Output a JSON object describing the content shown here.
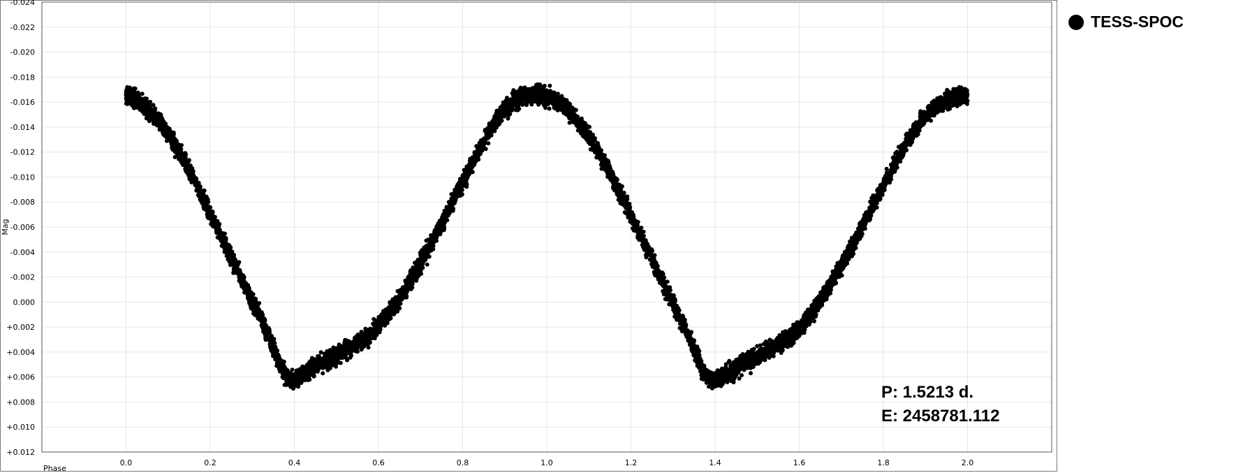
{
  "chart_data": {
    "type": "scatter",
    "title": "",
    "xlabel": "Phase",
    "ylabel": "Mag",
    "xlim": [
      -0.2,
      2.2
    ],
    "ylim": [
      0.012,
      -0.024
    ],
    "y_inverted": true,
    "grid": true,
    "x_ticks": [
      0.0,
      0.2,
      0.4,
      0.6,
      0.8,
      1.0,
      1.2,
      1.4,
      1.6,
      1.8,
      2.0
    ],
    "x_tick_labels": [
      "0.0",
      "0.2",
      "0.4",
      "0.6",
      "0.8",
      "1.0",
      "1.2",
      "1.4",
      "1.6",
      "1.8",
      "2.0"
    ],
    "y_ticks": [
      -0.024,
      -0.022,
      -0.02,
      -0.018,
      -0.016,
      -0.014,
      -0.012,
      -0.01,
      -0.008,
      -0.006,
      -0.004,
      -0.002,
      0.0,
      0.002,
      0.004,
      0.006,
      0.008,
      0.01,
      0.012
    ],
    "y_tick_labels": [
      "-0.024",
      "-0.022",
      "-0.020",
      "-0.018",
      "-0.016",
      "-0.014",
      "-0.012",
      "-0.010",
      "-0.008",
      "-0.006",
      "-0.004",
      "-0.002",
      "0.000",
      "+0.002",
      "+0.004",
      "+0.006",
      "+0.008",
      "+0.010",
      "+0.012"
    ],
    "legend": {
      "placement": "right",
      "entries": [
        "TESS-SPOC"
      ]
    },
    "series": [
      {
        "name": "TESS-SPOC",
        "color": "#000000",
        "marker": "filled-circle",
        "x": [
          0.0,
          0.02,
          0.04,
          0.06,
          0.08,
          0.1,
          0.12,
          0.14,
          0.16,
          0.18,
          0.2,
          0.22,
          0.24,
          0.26,
          0.28,
          0.3,
          0.32,
          0.34,
          0.36,
          0.38,
          0.4,
          0.42,
          0.44,
          0.46,
          0.48,
          0.5,
          0.52,
          0.54,
          0.56,
          0.58,
          0.6,
          0.62,
          0.64,
          0.66,
          0.68,
          0.7,
          0.72,
          0.74,
          0.76,
          0.78,
          0.8,
          0.82,
          0.84,
          0.86,
          0.88,
          0.9,
          0.92,
          0.94,
          0.96,
          0.98,
          1.0,
          1.02,
          1.04,
          1.06,
          1.08,
          1.1,
          1.12,
          1.14,
          1.16,
          1.18,
          1.2,
          1.22,
          1.24,
          1.26,
          1.28,
          1.3,
          1.32,
          1.34,
          1.36,
          1.38,
          1.4,
          1.42,
          1.44,
          1.46,
          1.48,
          1.5,
          1.52,
          1.54,
          1.56,
          1.58,
          1.6,
          1.62,
          1.64,
          1.66,
          1.68,
          1.7,
          1.72,
          1.74,
          1.76,
          1.78,
          1.8,
          1.82,
          1.84,
          1.86,
          1.88,
          1.9,
          1.92,
          1.94,
          1.96,
          1.98,
          2.0
        ],
        "y": [
          -0.0165,
          -0.0163,
          -0.0158,
          -0.0152,
          -0.0145,
          -0.0135,
          -0.0124,
          -0.0112,
          -0.0099,
          -0.0085,
          -0.0071,
          -0.0057,
          -0.0043,
          -0.0029,
          -0.0015,
          -0.0001,
          0.0013,
          0.0027,
          0.0045,
          0.006,
          0.0062,
          0.0058,
          0.0054,
          0.005,
          0.0046,
          0.0043,
          0.0039,
          0.0035,
          0.0031,
          0.0025,
          0.0019,
          0.0011,
          0.0002,
          -0.0008,
          -0.0019,
          -0.0031,
          -0.0043,
          -0.0056,
          -0.0069,
          -0.0082,
          -0.0096,
          -0.0109,
          -0.0122,
          -0.0134,
          -0.0145,
          -0.0154,
          -0.016,
          -0.0164,
          -0.0166,
          -0.0166,
          -0.0165,
          -0.0162,
          -0.0157,
          -0.015,
          -0.0142,
          -0.0132,
          -0.0121,
          -0.0109,
          -0.0096,
          -0.0083,
          -0.0069,
          -0.0055,
          -0.0041,
          -0.0027,
          -0.0013,
          0.0001,
          0.0015,
          0.003,
          0.0046,
          0.006,
          0.0063,
          0.0059,
          0.0055,
          0.0051,
          0.0047,
          0.0044,
          0.004,
          0.0036,
          0.0032,
          0.0027,
          0.0021,
          0.0013,
          0.0004,
          -0.0006,
          -0.0017,
          -0.0029,
          -0.0041,
          -0.0054,
          -0.0067,
          -0.008,
          -0.0093,
          -0.0106,
          -0.0118,
          -0.013,
          -0.014,
          -0.0149,
          -0.0155,
          -0.016,
          -0.0163,
          -0.0165,
          -0.0166
        ],
        "scatter_width_mag": 0.0012
      }
    ],
    "annotations": [
      "P: 1.5213 d.",
      "E: 2458781.112"
    ]
  }
}
